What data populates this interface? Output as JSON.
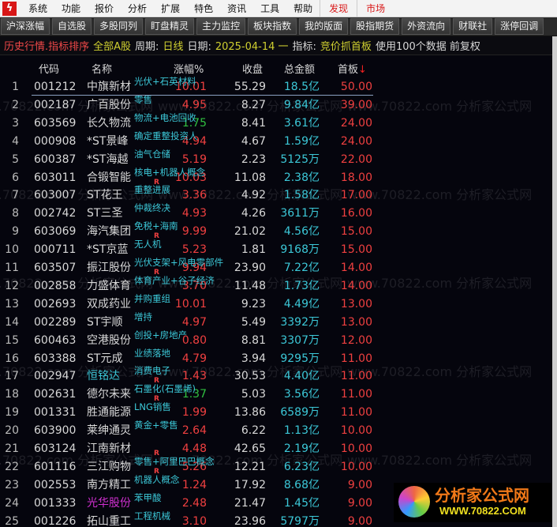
{
  "menu": [
    "系统",
    "功能",
    "报价",
    "分析",
    "扩展",
    "特色",
    "资讯",
    "工具",
    "帮助"
  ],
  "menu_red": [
    "发现",
    "市场"
  ],
  "toolbar": [
    "沪深涨幅",
    "自选股",
    "多股同列",
    "盯盘精灵",
    "主力监控",
    "板块指数",
    "我的版面",
    "股指期货",
    "外资流向",
    "财联社",
    "涨停回调"
  ],
  "info": {
    "title": "历史行情.指标排序",
    "market": "全部A股",
    "period_label": "周期:",
    "period": "日线",
    "date_label": "日期:",
    "date": "2025-04-14 一",
    "indicator_label": "指标:",
    "indicator": "竞价抓首板",
    "extra": "使用100个数据 前复权"
  },
  "columns": {
    "code": "代码",
    "name": "名称",
    "chg": "涨幅%",
    "close": "收盘",
    "amount": "总金额",
    "first": "首板",
    "sort_arrow": "↓"
  },
  "watermark": "www.70822.com 分析家公式网",
  "brand": {
    "name": "分析家公式网",
    "url": "WWW.70822.COM"
  },
  "colors": {
    "up": "#f04040",
    "down": "#30c040",
    "cyan": "#3cc8d8",
    "magenta": "#d030d0"
  },
  "rows": [
    {
      "i": "1",
      "code": "001212",
      "name": "中旗新材",
      "tag": "光伏+石英材料",
      "chg": "10.01",
      "close": "55.29",
      "amt": "18.5亿",
      "first": "50.00"
    },
    {
      "i": "2",
      "code": "002187",
      "name": "广百股份",
      "tag": "零售",
      "chg": "4.95",
      "close": "8.27",
      "amt": "9.84亿",
      "first": "39.00"
    },
    {
      "i": "3",
      "code": "603569",
      "name": "长久物流",
      "tag": "物流+电池回收",
      "chg": "1.75",
      "close": "8.41",
      "amt": "3.61亿",
      "first": "24.00",
      "down": true
    },
    {
      "i": "4",
      "code": "000908",
      "name": "*ST景峰",
      "tag": "确定重整投资人",
      "chg": "4.94",
      "close": "4.67",
      "amt": "1.59亿",
      "first": "24.00"
    },
    {
      "i": "5",
      "code": "600387",
      "name": "*ST海越",
      "tag": "油气仓储",
      "chg": "5.19",
      "close": "2.23",
      "amt": "5125万",
      "first": "22.00"
    },
    {
      "i": "6",
      "code": "603011",
      "name": "合锻智能",
      "tag": "核电+机器人概念",
      "chg": "10.03",
      "close": "11.08",
      "amt": "2.38亿",
      "first": "18.00",
      "r": "R"
    },
    {
      "i": "7",
      "code": "603007",
      "name": "ST花王",
      "tag": "重整进展",
      "chg": "3.36",
      "close": "4.92",
      "amt": "1.58亿",
      "first": "17.00"
    },
    {
      "i": "8",
      "code": "002742",
      "name": "ST三圣",
      "tag": "仲裁终决",
      "chg": "4.93",
      "close": "4.26",
      "amt": "3611万",
      "first": "16.00"
    },
    {
      "i": "9",
      "code": "603069",
      "name": "海汽集团",
      "tag": "免税+海南",
      "chg": "9.99",
      "close": "21.02",
      "amt": "4.56亿",
      "first": "15.00",
      "r": "R"
    },
    {
      "i": "10",
      "code": "000711",
      "name": "*ST京蓝",
      "tag": "无人机",
      "chg": "5.23",
      "close": "1.81",
      "amt": "9168万",
      "first": "15.00"
    },
    {
      "i": "11",
      "code": "603507",
      "name": "振江股份",
      "tag": "光伏支架+风电零部件",
      "chg": "9.94",
      "close": "23.90",
      "amt": "7.22亿",
      "first": "14.00",
      "r": "R"
    },
    {
      "i": "12",
      "code": "002858",
      "name": "力盛体育",
      "tag": "体育产业+谷子经济",
      "chg": "3.70",
      "close": "11.48",
      "amt": "1.73亿",
      "first": "14.00"
    },
    {
      "i": "13",
      "code": "002693",
      "name": "双成药业",
      "tag": "并购重组",
      "chg": "10.01",
      "close": "9.23",
      "amt": "4.49亿",
      "first": "13.00"
    },
    {
      "i": "14",
      "code": "002289",
      "name": "ST宇顺",
      "tag": "增持",
      "chg": "4.97",
      "close": "5.49",
      "amt": "3392万",
      "first": "13.00"
    },
    {
      "i": "15",
      "code": "600463",
      "name": "空港股份",
      "tag": "创投+房地产",
      "chg": "0.80",
      "close": "8.81",
      "amt": "3307万",
      "first": "12.00"
    },
    {
      "i": "16",
      "code": "603388",
      "name": "ST元成",
      "tag": "业绩落地",
      "chg": "4.79",
      "close": "3.94",
      "amt": "9295万",
      "first": "11.00"
    },
    {
      "i": "17",
      "code": "002947",
      "name": "恒铭达",
      "tag": "消费电子",
      "chg": "1.43",
      "close": "30.53",
      "amt": "4.40亿",
      "first": "11.00",
      "r": "R",
      "nameColor": "cyan"
    },
    {
      "i": "18",
      "code": "002631",
      "name": "德尔未来",
      "tag": "石墨化(石墨烯)",
      "chg": "1.37",
      "close": "5.03",
      "amt": "3.56亿",
      "first": "11.00",
      "r": "R",
      "down": true
    },
    {
      "i": "19",
      "code": "001331",
      "name": "胜通能源",
      "tag": "LNG销售",
      "chg": "1.99",
      "close": "13.86",
      "amt": "6589万",
      "first": "11.00"
    },
    {
      "i": "20",
      "code": "603900",
      "name": "莱绅通灵",
      "tag": "黄金+零售",
      "chg": "2.64",
      "close": "6.22",
      "amt": "1.13亿",
      "first": "10.00"
    },
    {
      "i": "21",
      "code": "603124",
      "name": "江南新材",
      "tag": "",
      "chg": "4.48",
      "close": "42.65",
      "amt": "2.19亿",
      "first": "10.00",
      "r": "R"
    },
    {
      "i": "22",
      "code": "601116",
      "name": "三江购物",
      "tag": "零售+阿里巴巴概念",
      "chg": "5.26",
      "close": "12.21",
      "amt": "6.23亿",
      "first": "10.00",
      "r": "R"
    },
    {
      "i": "23",
      "code": "002553",
      "name": "南方精工",
      "tag": "机器人概念",
      "chg": "1.24",
      "close": "17.92",
      "amt": "8.68亿",
      "first": "9.00"
    },
    {
      "i": "24",
      "code": "001333",
      "name": "光华股份",
      "tag": "苯甲酸",
      "chg": "2.48",
      "close": "21.47",
      "amt": "1.45亿",
      "first": "9.00",
      "nameColor": "magenta"
    },
    {
      "i": "25",
      "code": "001226",
      "name": "拓山重工",
      "tag": "工程机械",
      "chg": "3.10",
      "close": "23.96",
      "amt": "5797万",
      "first": "9.00"
    }
  ]
}
